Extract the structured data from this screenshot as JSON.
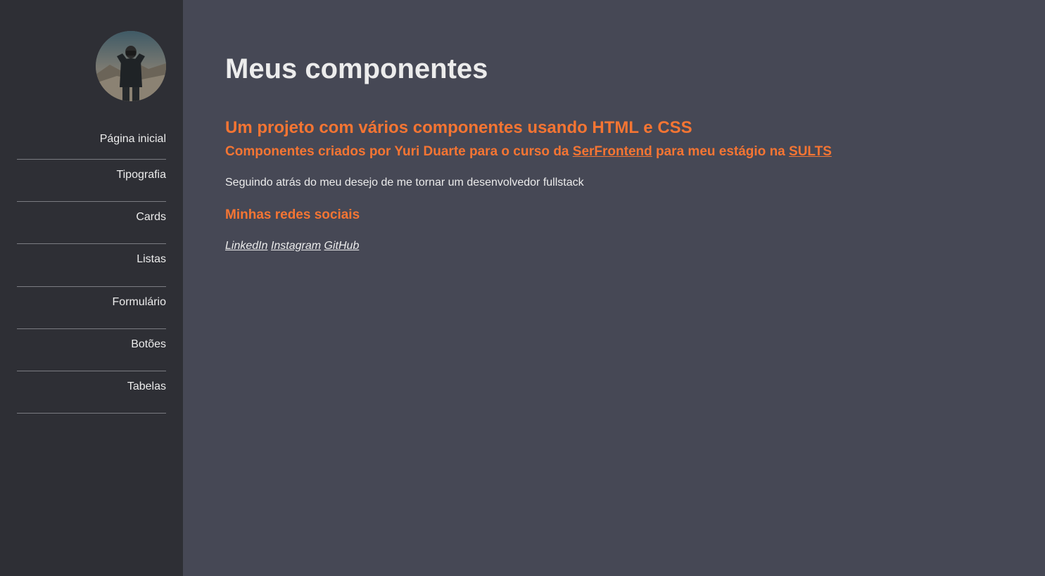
{
  "sidebar": {
    "avatar_icon": "profile-photo",
    "items": [
      {
        "label": "Página inicial"
      },
      {
        "label": "Tipografia"
      },
      {
        "label": "Cards"
      },
      {
        "label": "Listas"
      },
      {
        "label": "Formulário"
      },
      {
        "label": "Botões"
      },
      {
        "label": "Tabelas"
      }
    ]
  },
  "main": {
    "title": "Meus componentes",
    "subtitle": "Um projeto com vários componentes usando HTML e CSS",
    "credits": {
      "prefix": "Componentes criados por Yuri Duarte para o curso da ",
      "link1": "SerFrontend",
      "middle": " para meu estágio na ",
      "link2": "SULTS"
    },
    "description": "Seguindo atrás do meu desejo de me tornar um desenvolvedor fullstack",
    "social_heading": "Minhas redes sociais",
    "social_links": [
      {
        "label": "LinkedIn"
      },
      {
        "label": "Instagram"
      },
      {
        "label": "GitHub"
      }
    ]
  },
  "colors": {
    "sidebar_bg": "#2e2f35",
    "main_bg": "#464855",
    "accent": "#f57533",
    "text": "#ececec"
  }
}
